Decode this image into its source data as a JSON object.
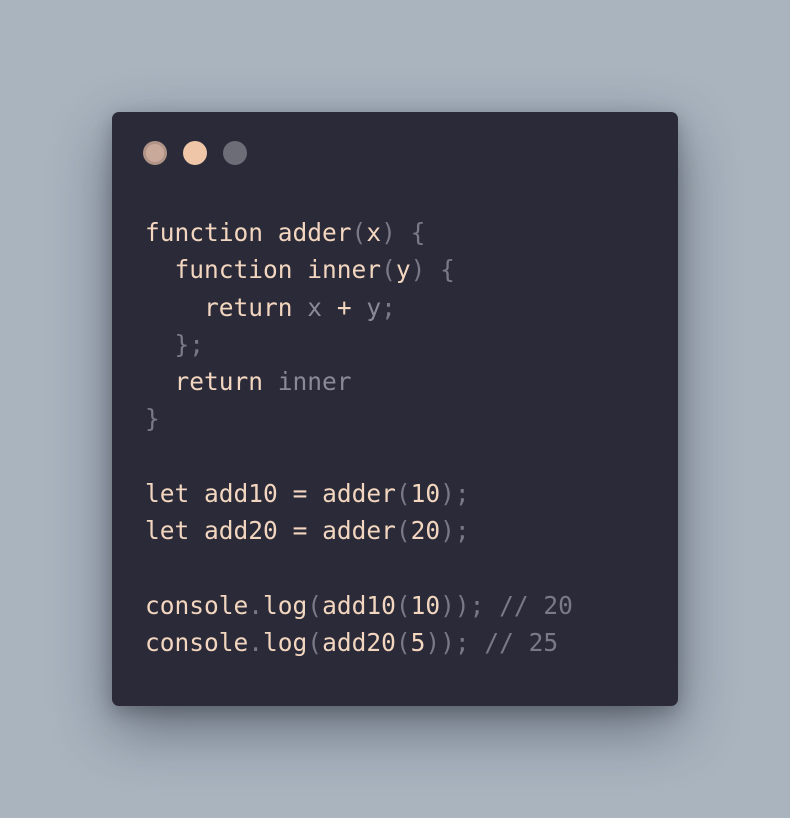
{
  "window": {
    "colors": {
      "background": "#2a2a38",
      "page_background": "#a9b4bf",
      "text": "#f3d6bf",
      "punctuation": "#7a7a87",
      "dot_close": "#c9a99a",
      "dot_minimize": "#f0c6a8",
      "dot_maximize": "#6d6d78"
    },
    "controls": [
      "close-dot",
      "minimize-dot",
      "maximize-dot"
    ]
  },
  "code": {
    "lines": [
      [
        {
          "t": "kw",
          "v": "function"
        },
        {
          "t": "sp",
          "v": " "
        },
        {
          "t": "fn",
          "v": "adder"
        },
        {
          "t": "pun",
          "v": "("
        },
        {
          "t": "id",
          "v": "x"
        },
        {
          "t": "pun",
          "v": ")"
        },
        {
          "t": "sp",
          "v": " "
        },
        {
          "t": "pun",
          "v": "{"
        }
      ],
      [
        {
          "t": "sp",
          "v": "  "
        },
        {
          "t": "kw",
          "v": "function"
        },
        {
          "t": "sp",
          "v": " "
        },
        {
          "t": "fn",
          "v": "inner"
        },
        {
          "t": "pun",
          "v": "("
        },
        {
          "t": "id",
          "v": "y"
        },
        {
          "t": "pun",
          "v": ")"
        },
        {
          "t": "sp",
          "v": " "
        },
        {
          "t": "pun",
          "v": "{"
        }
      ],
      [
        {
          "t": "sp",
          "v": "    "
        },
        {
          "t": "kw",
          "v": "return"
        },
        {
          "t": "sp",
          "v": " "
        },
        {
          "t": "dim",
          "v": "x"
        },
        {
          "t": "sp",
          "v": " "
        },
        {
          "t": "id",
          "v": "+"
        },
        {
          "t": "sp",
          "v": " "
        },
        {
          "t": "dim",
          "v": "y"
        },
        {
          "t": "pun",
          "v": ";"
        }
      ],
      [
        {
          "t": "sp",
          "v": "  "
        },
        {
          "t": "pun",
          "v": "};"
        }
      ],
      [
        {
          "t": "sp",
          "v": "  "
        },
        {
          "t": "kw",
          "v": "return"
        },
        {
          "t": "sp",
          "v": " "
        },
        {
          "t": "dim",
          "v": "inner"
        }
      ],
      [
        {
          "t": "pun",
          "v": "}"
        }
      ],
      [],
      [
        {
          "t": "kw",
          "v": "let"
        },
        {
          "t": "sp",
          "v": " "
        },
        {
          "t": "id",
          "v": "add10"
        },
        {
          "t": "sp",
          "v": " "
        },
        {
          "t": "id",
          "v": "="
        },
        {
          "t": "sp",
          "v": " "
        },
        {
          "t": "fn",
          "v": "adder"
        },
        {
          "t": "pun",
          "v": "("
        },
        {
          "t": "num",
          "v": "10"
        },
        {
          "t": "pun",
          "v": ");"
        }
      ],
      [
        {
          "t": "kw",
          "v": "let"
        },
        {
          "t": "sp",
          "v": " "
        },
        {
          "t": "id",
          "v": "add20"
        },
        {
          "t": "sp",
          "v": " "
        },
        {
          "t": "id",
          "v": "="
        },
        {
          "t": "sp",
          "v": " "
        },
        {
          "t": "fn",
          "v": "adder"
        },
        {
          "t": "pun",
          "v": "("
        },
        {
          "t": "num",
          "v": "20"
        },
        {
          "t": "pun",
          "v": ");"
        }
      ],
      [],
      [
        {
          "t": "id",
          "v": "console"
        },
        {
          "t": "pun",
          "v": "."
        },
        {
          "t": "fn",
          "v": "log"
        },
        {
          "t": "pun",
          "v": "("
        },
        {
          "t": "fn",
          "v": "add10"
        },
        {
          "t": "pun",
          "v": "("
        },
        {
          "t": "num",
          "v": "10"
        },
        {
          "t": "pun",
          "v": "));"
        },
        {
          "t": "sp",
          "v": " "
        },
        {
          "t": "com",
          "v": "// 20"
        }
      ],
      [
        {
          "t": "id",
          "v": "console"
        },
        {
          "t": "pun",
          "v": "."
        },
        {
          "t": "fn",
          "v": "log"
        },
        {
          "t": "pun",
          "v": "("
        },
        {
          "t": "fn",
          "v": "add20"
        },
        {
          "t": "pun",
          "v": "("
        },
        {
          "t": "num",
          "v": "5"
        },
        {
          "t": "pun",
          "v": "));"
        },
        {
          "t": "sp",
          "v": " "
        },
        {
          "t": "com",
          "v": "// 25"
        }
      ]
    ]
  }
}
